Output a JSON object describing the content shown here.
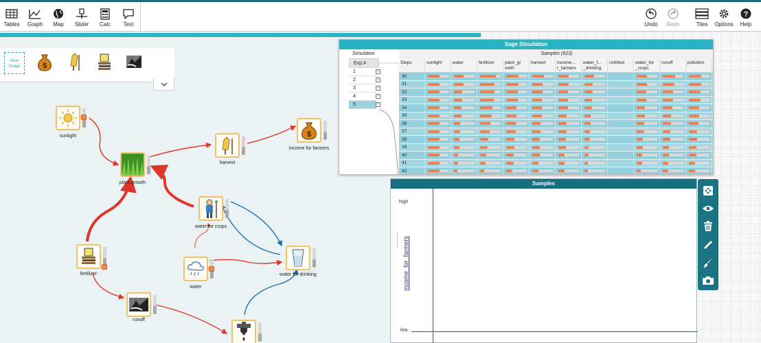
{
  "toolbar": {
    "left": [
      {
        "label": "Tables",
        "icon": "table-icon"
      },
      {
        "label": "Graph",
        "icon": "graph-icon"
      },
      {
        "label": "Map",
        "icon": "globe-icon"
      },
      {
        "label": "Slider",
        "icon": "slider-icon"
      },
      {
        "label": "Calc",
        "icon": "calculator-icon"
      },
      {
        "label": "Text",
        "icon": "text-icon"
      }
    ],
    "right": [
      {
        "label": "Undo",
        "icon": "undo-icon"
      },
      {
        "label": "Redo",
        "icon": "redo-icon"
      },
      {
        "label": "Tiles",
        "icon": "tiles-icon"
      },
      {
        "label": "Options",
        "icon": "gear-icon"
      },
      {
        "label": "Help",
        "icon": "help-icon"
      }
    ]
  },
  "palette": {
    "new_image_line1": "New",
    "new_image_line2": "Image",
    "images": [
      "money-bag-icon",
      "harvest-icon",
      "fertilizer-icon",
      "runoff-icon"
    ]
  },
  "nodes": {
    "sunlight": "sunlight",
    "plant_growth": "plant growth",
    "harvest": "harvest",
    "income": "income for farmers",
    "water_crops": "water for crops",
    "fertilizer": "fertilizer",
    "water": "water",
    "water_drinking": "water for drinking",
    "runoff": "runoff"
  },
  "sim": {
    "title": "Sage Simulation",
    "simulation_label": "Simulation",
    "exp_header": "Exp.#",
    "experiments": [
      "1",
      "2",
      "3",
      "4",
      "5"
    ],
    "samples_caption": "Samples (623)",
    "columns": [
      "Steps",
      "sunlight",
      "water",
      "fertilizer",
      "plant_growth",
      "harvest",
      "income_for_farmers",
      "water_for_drinking",
      "Untitled",
      "water_for_crops",
      "runoff",
      "pollution"
    ],
    "column_labels": [
      "Steps",
      "sunlight",
      "water",
      "fertilizer",
      "plant_gr\nowth",
      "harvest",
      "income...\nr_farmers",
      "water_f...\n_drinking",
      "Untitled",
      "water_for\n_crops",
      "runoff",
      "pollution"
    ],
    "steps": [
      "30",
      "31",
      "32",
      "33",
      "34",
      "35",
      "36",
      "37",
      "38",
      "39",
      "40",
      "41",
      "42"
    ],
    "rows": [
      [
        0.55,
        0.45,
        0.75,
        0.6,
        0.55,
        0.5,
        0.45,
        0,
        0.5,
        0.6,
        0.6
      ],
      [
        0.55,
        0.45,
        0.7,
        0.6,
        0.5,
        0.5,
        0.4,
        0,
        0.5,
        0.55,
        0.6
      ],
      [
        0.55,
        0.4,
        0.7,
        0.55,
        0.5,
        0.45,
        0.4,
        0,
        0.45,
        0.5,
        0.55
      ],
      [
        0.55,
        0.4,
        0.65,
        0.55,
        0.45,
        0.45,
        0.35,
        0,
        0.45,
        0.5,
        0.55
      ],
      [
        0.55,
        0.35,
        0.6,
        0.5,
        0.45,
        0.45,
        0.35,
        0,
        0.4,
        0.45,
        0.5
      ],
      [
        0.55,
        0.35,
        0.55,
        0.5,
        0.45,
        0.4,
        0.3,
        0,
        0.4,
        0.4,
        0.5
      ],
      [
        0.55,
        0.3,
        0.5,
        0.45,
        0.4,
        0.4,
        0.3,
        0,
        0.35,
        0.4,
        0.45
      ],
      [
        0.55,
        0.3,
        0.45,
        0.45,
        0.4,
        0.4,
        0.25,
        0,
        0.35,
        0.35,
        0.4
      ],
      [
        0.55,
        0.25,
        0.4,
        0.4,
        0.35,
        0.35,
        0.25,
        0,
        0.3,
        0.35,
        0.4
      ],
      [
        0.55,
        0.25,
        0.35,
        0.4,
        0.35,
        0.35,
        0.2,
        0,
        0.3,
        0.3,
        0.35
      ],
      [
        0.55,
        0.2,
        0.3,
        0.35,
        0.35,
        0.3,
        0.2,
        0,
        0.25,
        0.3,
        0.35
      ],
      [
        0.55,
        0.2,
        0.25,
        0.35,
        0.3,
        0.3,
        0.15,
        0,
        0.25,
        0.25,
        0.3
      ],
      [
        0.55,
        0.15,
        0.2,
        0.3,
        0.3,
        0.3,
        0.15,
        0,
        0.2,
        0.25,
        0.3
      ]
    ]
  },
  "graph": {
    "title": "Samples",
    "y_high": "high",
    "y_low": "low",
    "y_axis": "income_for_farmers"
  },
  "tool_strip": [
    "move-icon",
    "eye-icon",
    "trash-icon",
    "ruler-icon",
    "brush-icon",
    "camera-icon"
  ],
  "colors": {
    "accent": "#2ab3c3",
    "dark_teal": "#17707f",
    "link_red": "#e0352b",
    "link_blue": "#1f6fb0",
    "bar_orange": "#ef7f4f"
  }
}
